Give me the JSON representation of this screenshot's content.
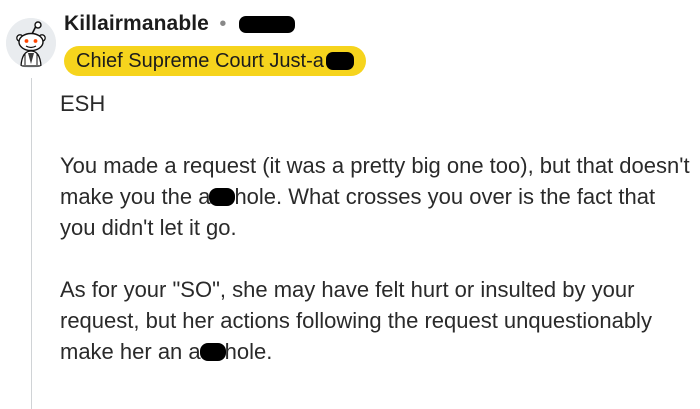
{
  "comment": {
    "author": "Killairmanable",
    "separator": "•",
    "flair": "Chief Supreme Court Just-a",
    "verdict": "ESH",
    "paragraph1": {
      "part1": "You made a request (it was a pretty big one too), but that doesn't make you the a",
      "part2": "hole. What crosses you over is the fact that you didn't let it go."
    },
    "paragraph2": {
      "part1": "As for your \"SO\", she may have felt hurt or insulted by your request, but her actions following the request unquestionably make her an a",
      "part2": "hole."
    }
  },
  "colors": {
    "flair_bg": "#f6d41d",
    "text": "#2a2a2a",
    "thread_line": "#d0d3d6"
  },
  "icons": {
    "avatar": "snoo-avatar-icon"
  }
}
